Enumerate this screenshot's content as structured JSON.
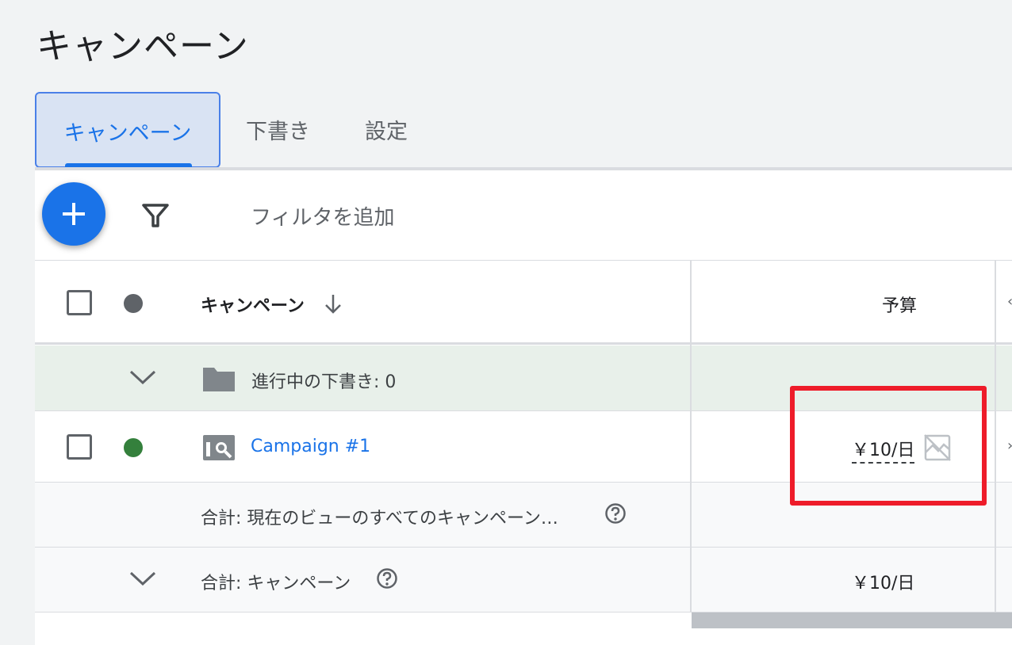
{
  "page": {
    "title": "キャンペーン"
  },
  "tabs": [
    {
      "label": "キャンペーン",
      "active": true
    },
    {
      "label": "下書き",
      "active": false
    },
    {
      "label": "設定",
      "active": false
    }
  ],
  "toolbar": {
    "add_icon": "plus-icon",
    "filter_icon": "filter-icon",
    "filter_label": "フィルタを追加"
  },
  "table": {
    "headers": {
      "campaign": "キャンペーン",
      "budget": "予算"
    },
    "draft_row": {
      "text": "進行中の下書き: 0",
      "icon": "folder-icon"
    },
    "campaign_row": {
      "name": "Campaign #1",
      "budget": "￥10/日",
      "status_color": "#34803c",
      "icon": "campaign-icon"
    },
    "total_view_row": {
      "text": "合計: 現在のビューのすべてのキャンペーン…"
    },
    "total_campaign_row": {
      "text": "合計: キャンペーン",
      "budget": "￥10/日"
    }
  },
  "colors": {
    "accent": "#1a73e8",
    "highlight": "#ee1c2a",
    "draft_row_bg": "#e8f0ea"
  }
}
